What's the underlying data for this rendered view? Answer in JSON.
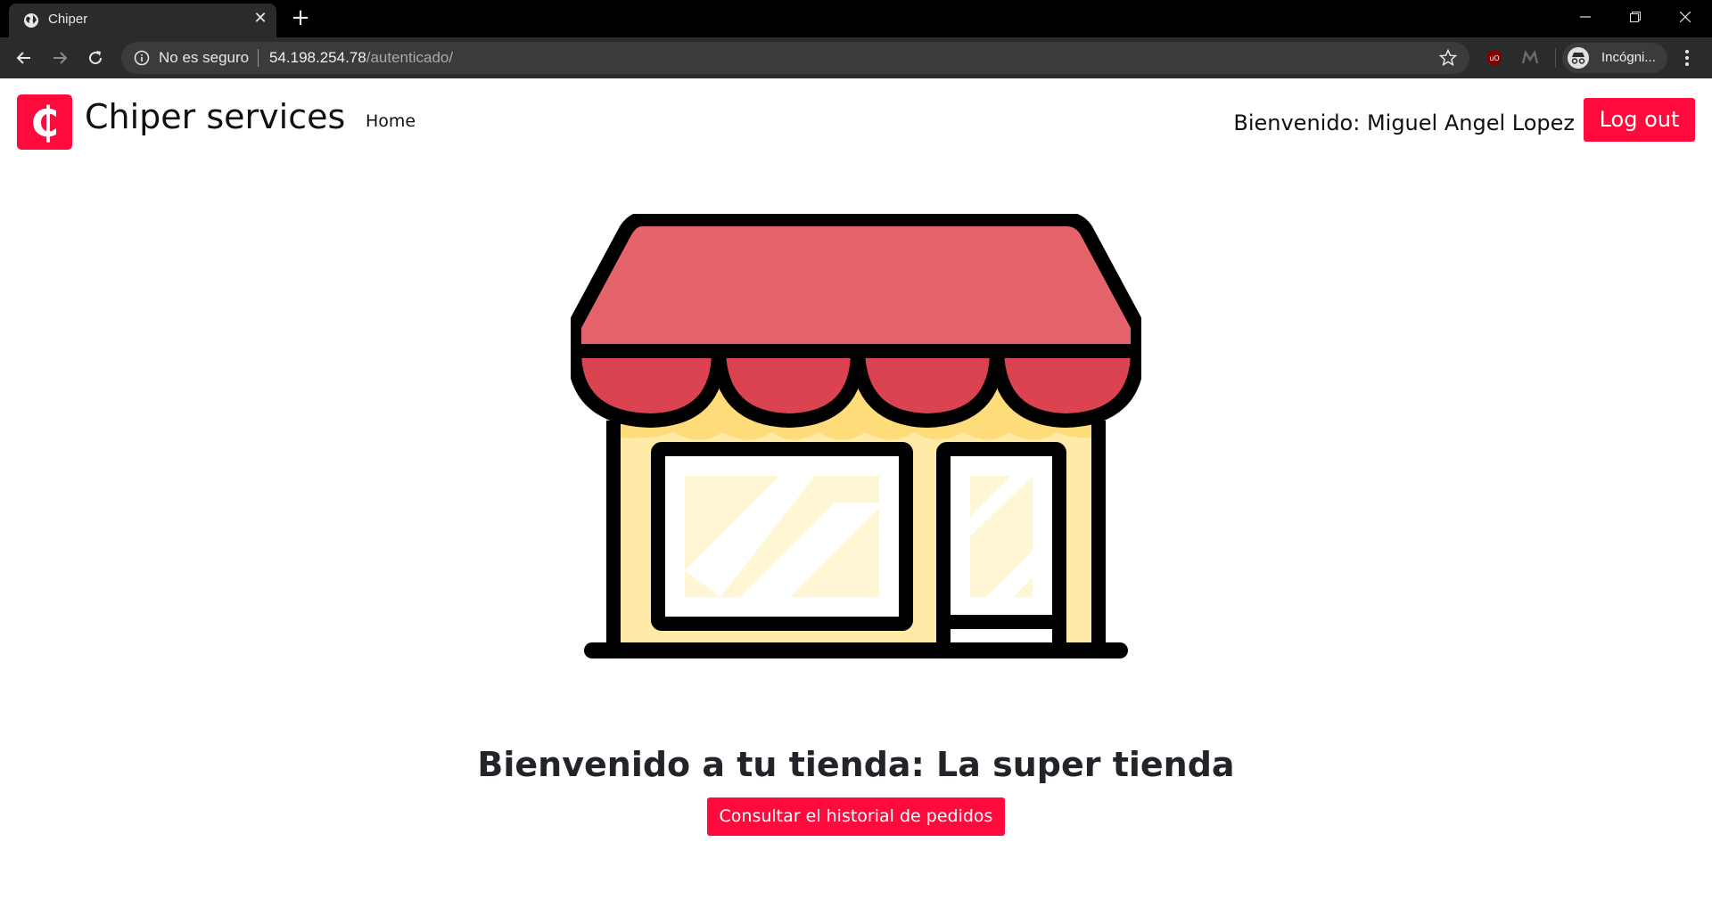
{
  "browser": {
    "tab_title": "Chiper",
    "not_secure_label": "No es seguro",
    "url_host": "54.198.254.78",
    "url_path": "/autenticado/",
    "profile_label": "Incógni..."
  },
  "navbar": {
    "logo_glyph": "₵",
    "brand_name": "Chiper services",
    "home_link": "Home",
    "welcome_label": "Bienvenido: Miguel Angel Lopez",
    "logout_label": "Log out"
  },
  "main": {
    "store_title": "Bienvenido a tu tienda: La super tienda",
    "history_button": "Consultar el historial de pedidos"
  },
  "colors": {
    "brand_red": "#ff0a3c",
    "awning_top": "#e5636b",
    "awning_scallop": "#db4350",
    "wall": "#ffeaa7",
    "chrome_dark": "#2b2b2b"
  }
}
